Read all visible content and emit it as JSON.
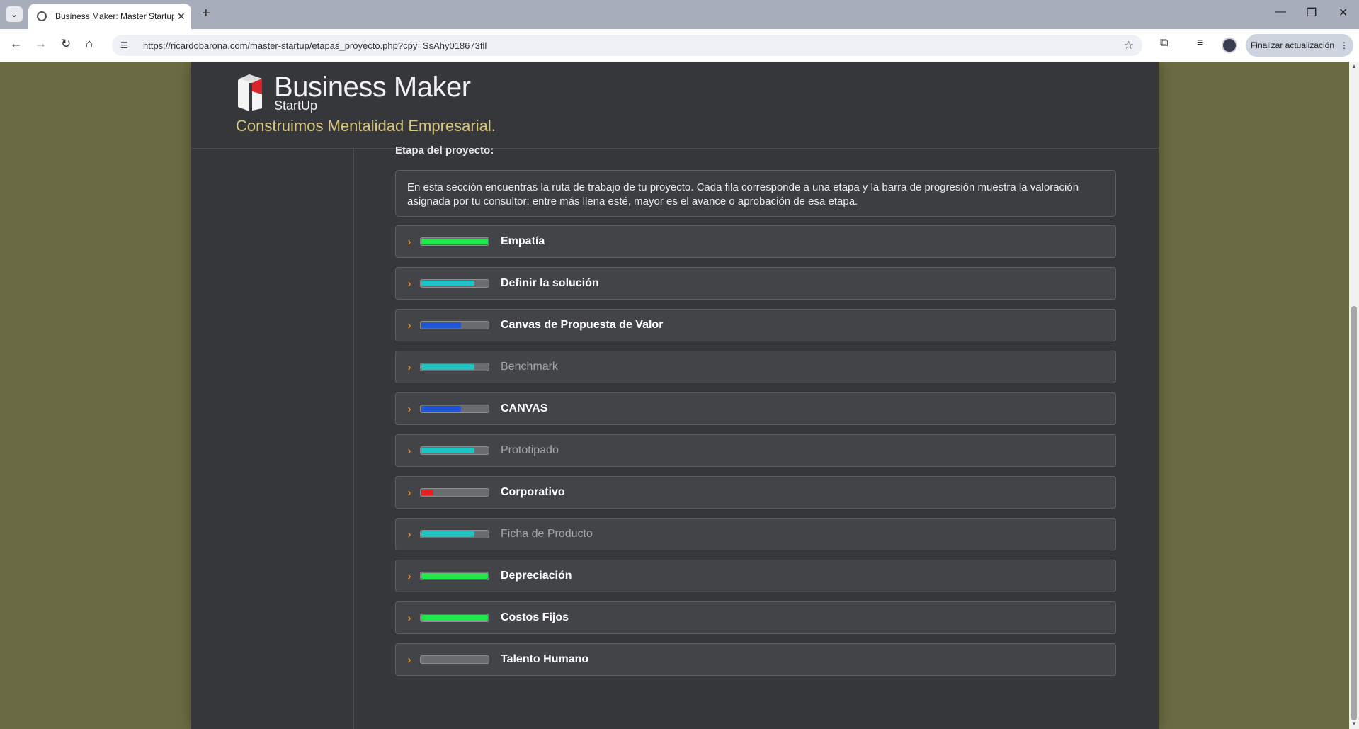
{
  "browser": {
    "tab_title": "Business Maker: Master Startup",
    "url": "https://ricardobarona.com/master-startup/etapas_proyecto.php?cpy=SsAhy018673fll",
    "update_label": "Finalizar actualización"
  },
  "header": {
    "brand": "Business Maker",
    "brand_sub": "StartUp",
    "tagline": "Construimos Mentalidad Empresarial."
  },
  "main": {
    "section_title": "Etapa del proyecto:",
    "info_text": "En esta sección encuentras la ruta de trabajo de tu proyecto. Cada fila corresponde a una etapa y la barra de progresión muestra la valoración asignada por tu consultor: entre más llena esté, mayor es el avance o aprobación de esa etapa."
  },
  "stages": [
    {
      "label": "Empatía",
      "progress": 1.0,
      "color": "#1ee84c",
      "style": "bold"
    },
    {
      "label": "Definir la solución",
      "progress": 0.8,
      "color": "#1ec4c4",
      "style": "bold"
    },
    {
      "label": "Canvas de Propuesta de Valor",
      "progress": 0.6,
      "color": "#1f55d6",
      "style": "bold"
    },
    {
      "label": "Benchmark",
      "progress": 0.8,
      "color": "#1ec4c4",
      "style": "dim"
    },
    {
      "label": "CANVAS",
      "progress": 0.6,
      "color": "#1f55d6",
      "style": "bold"
    },
    {
      "label": "Prototipado",
      "progress": 0.8,
      "color": "#1ec4c4",
      "style": "dim"
    },
    {
      "label": "Corporativo",
      "progress": 0.2,
      "color": "#ee1c1c",
      "style": "bold"
    },
    {
      "label": "Ficha de Producto",
      "progress": 0.8,
      "color": "#1ec4c4",
      "style": "dim"
    },
    {
      "label": "Depreciación",
      "progress": 1.0,
      "color": "#1ee84c",
      "style": "bold"
    },
    {
      "label": "Costos Fijos",
      "progress": 1.0,
      "color": "#1ee84c",
      "style": "bold"
    },
    {
      "label": "Talento Humano",
      "progress": 0.0,
      "color": "#6a6c70",
      "style": "bold"
    }
  ]
}
